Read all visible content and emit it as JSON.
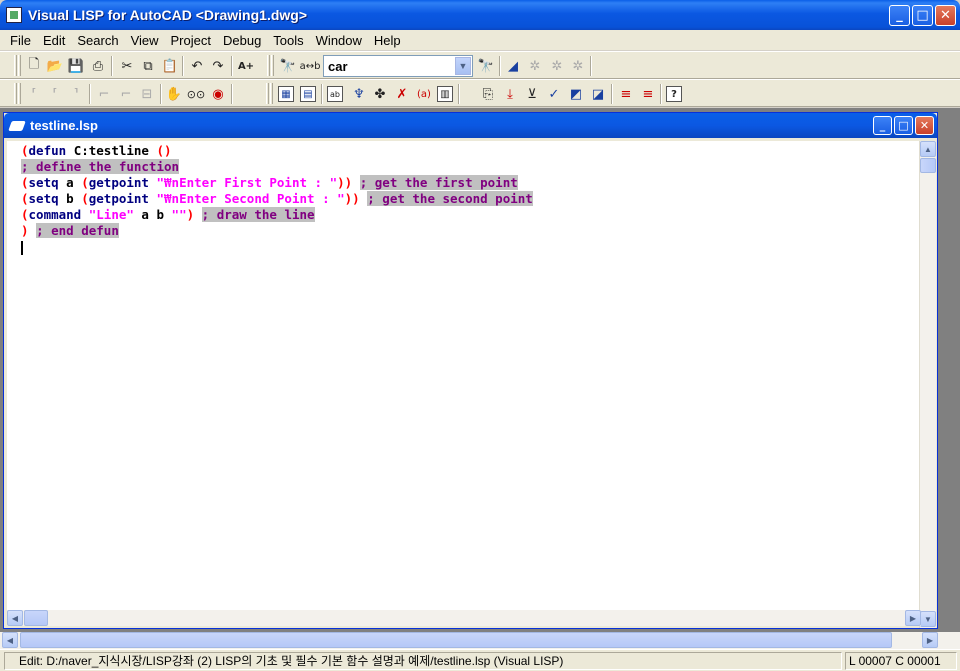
{
  "window": {
    "title": "Visual LISP for AutoCAD <Drawing1.dwg>"
  },
  "menu": [
    "File",
    "Edit",
    "Search",
    "View",
    "Project",
    "Debug",
    "Tools",
    "Window",
    "Help"
  ],
  "toolbar": {
    "search_combo_value": "car",
    "icons_row1": [
      "new-file-icon",
      "open-file-icon",
      "save-icon",
      "print-icon",
      "cut-icon",
      "copy-icon",
      "paste-icon",
      "undo-icon",
      "redo-icon",
      "complete-word-icon",
      "find-icon",
      "replace-icon",
      "find-toolbar-icon",
      "toggle-bookmark-icon",
      "next-bookmark-icon",
      "clear-bookmarks-icon",
      "bookmark-list-icon"
    ],
    "icons_row2": [
      "format-edit-window-icon",
      "format-selection-icon",
      "comment-block-icon",
      "uncomment-icon",
      "indent-icon",
      "outdent-icon",
      "pan-hand-icon",
      "inspect-glasses-icon",
      "trace-icon",
      "activate-autocad-icon",
      "load-window-icon",
      "load-selection-icon",
      "check-edit-window-icon",
      "check-selection-icon",
      "apropos-icon",
      "parentheses-match-icon",
      "help-book-icon",
      "step-into-icon",
      "step-over-icon",
      "step-out-icon",
      "continue-icon",
      "quit-icon",
      "reset-icon",
      "toggle-breakpoint-icon",
      "breakpoint-list-icon",
      "context-help-icon"
    ]
  },
  "document": {
    "title": "testline.lsp"
  },
  "code": [
    [
      {
        "t": "(",
        "c": "c-par"
      },
      {
        "t": "defun",
        "c": "c-kw"
      },
      {
        "t": " C:testline ",
        "c": "c-id"
      },
      {
        "t": "()",
        "c": "c-par"
      }
    ],
    [
      {
        "t": "; define the function",
        "c": "c-com"
      }
    ],
    [
      {
        "t": "(",
        "c": "c-par"
      },
      {
        "t": "setq",
        "c": "c-kw"
      },
      {
        "t": " a ",
        "c": "c-id"
      },
      {
        "t": "(",
        "c": "c-par"
      },
      {
        "t": "getpoint",
        "c": "c-kw"
      },
      {
        "t": " ",
        "c": "c-id"
      },
      {
        "t": "\"₩nEnter First Point : \"",
        "c": "c-str"
      },
      {
        "t": "))",
        "c": "c-par"
      },
      {
        "t": " ",
        "c": "c-id"
      },
      {
        "t": "; get the first point",
        "c": "c-com"
      }
    ],
    [
      {
        "t": "(",
        "c": "c-par"
      },
      {
        "t": "setq",
        "c": "c-kw"
      },
      {
        "t": " b ",
        "c": "c-id"
      },
      {
        "t": "(",
        "c": "c-par"
      },
      {
        "t": "getpoint",
        "c": "c-kw"
      },
      {
        "t": " ",
        "c": "c-id"
      },
      {
        "t": "\"₩nEnter Second Point : \"",
        "c": "c-str"
      },
      {
        "t": "))",
        "c": "c-par"
      },
      {
        "t": " ",
        "c": "c-id"
      },
      {
        "t": "; get the second point",
        "c": "c-com"
      }
    ],
    [
      {
        "t": "(",
        "c": "c-par"
      },
      {
        "t": "command",
        "c": "c-kw"
      },
      {
        "t": " ",
        "c": "c-id"
      },
      {
        "t": "\"Line\"",
        "c": "c-str"
      },
      {
        "t": " a b ",
        "c": "c-id"
      },
      {
        "t": "\"\"",
        "c": "c-str"
      },
      {
        "t": ")",
        "c": "c-par"
      },
      {
        "t": " ",
        "c": "c-id"
      },
      {
        "t": "; draw the line",
        "c": "c-com"
      }
    ],
    [
      {
        "t": ")",
        "c": "c-par"
      },
      {
        "t": " ",
        "c": "c-id"
      },
      {
        "t": "; end defun",
        "c": "c-com"
      }
    ]
  ],
  "status": {
    "main": "Edit:  D:/naver_지식시장/LISP강좌 (2) LISP의 기초 및 필수 기본 함수 설명과 예제/testline.lsp   (Visual LISP)",
    "position": "L 00007  C 00001"
  }
}
